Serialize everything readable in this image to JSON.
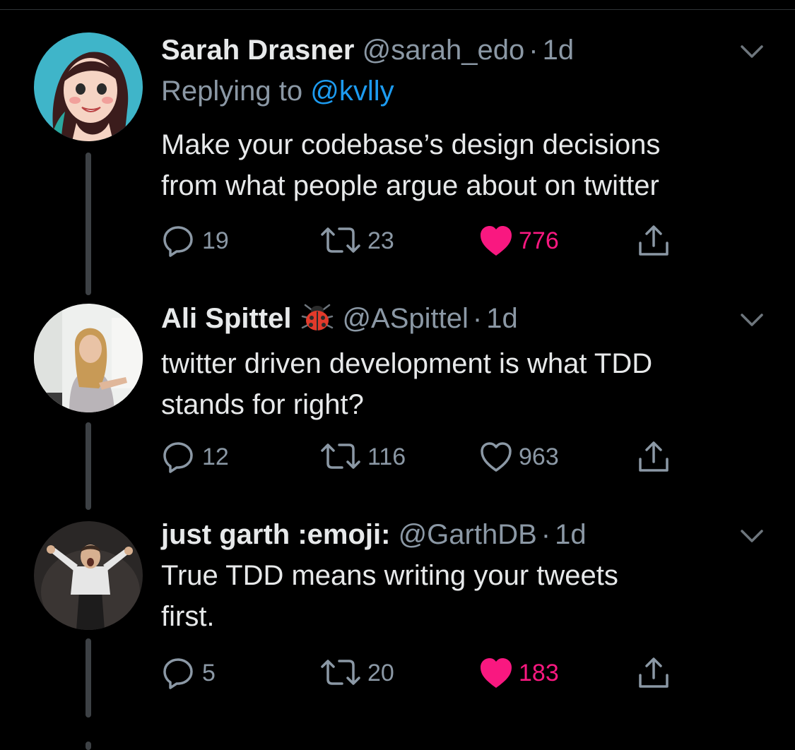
{
  "colors": {
    "background": "#000000",
    "primary_text": "#e7e9ea",
    "secondary_text": "#8b98a5",
    "link": "#1d9bf0",
    "like_active": "#f91880",
    "thread_line": "#3d4145"
  },
  "tweets": [
    {
      "name": "Sarah Drasner",
      "handle": "@sarah_edo",
      "sep": "·",
      "time": "1d",
      "replying_prefix": "Replying to",
      "replying_to": "@kvlly",
      "text_lines": [
        "Make your codebase’s design decisions",
        "from what people argue about on twitter"
      ],
      "replies": "19",
      "retweets": "23",
      "likes": "776",
      "liked": true,
      "avatar_icon": "cartoon-woman-avatar"
    },
    {
      "name": "Ali Spittel",
      "name_badge_icon": "ladybug-icon",
      "handle": "@ASpittel",
      "sep": "·",
      "time": "1d",
      "text_lines": [
        "twitter driven development is what TDD",
        "stands for right?"
      ],
      "replies": "12",
      "retweets": "116",
      "likes": "963",
      "liked": false,
      "avatar_icon": "photo-woman-avatar"
    },
    {
      "name": "just garth :emoji:",
      "handle": "@GarthDB",
      "sep": "·",
      "time": "1d",
      "text_lines": [
        "True TDD means writing your tweets",
        "first."
      ],
      "replies": "5",
      "retweets": "20",
      "likes": "183",
      "liked": true,
      "avatar_icon": "photo-boy-avatar"
    }
  ]
}
